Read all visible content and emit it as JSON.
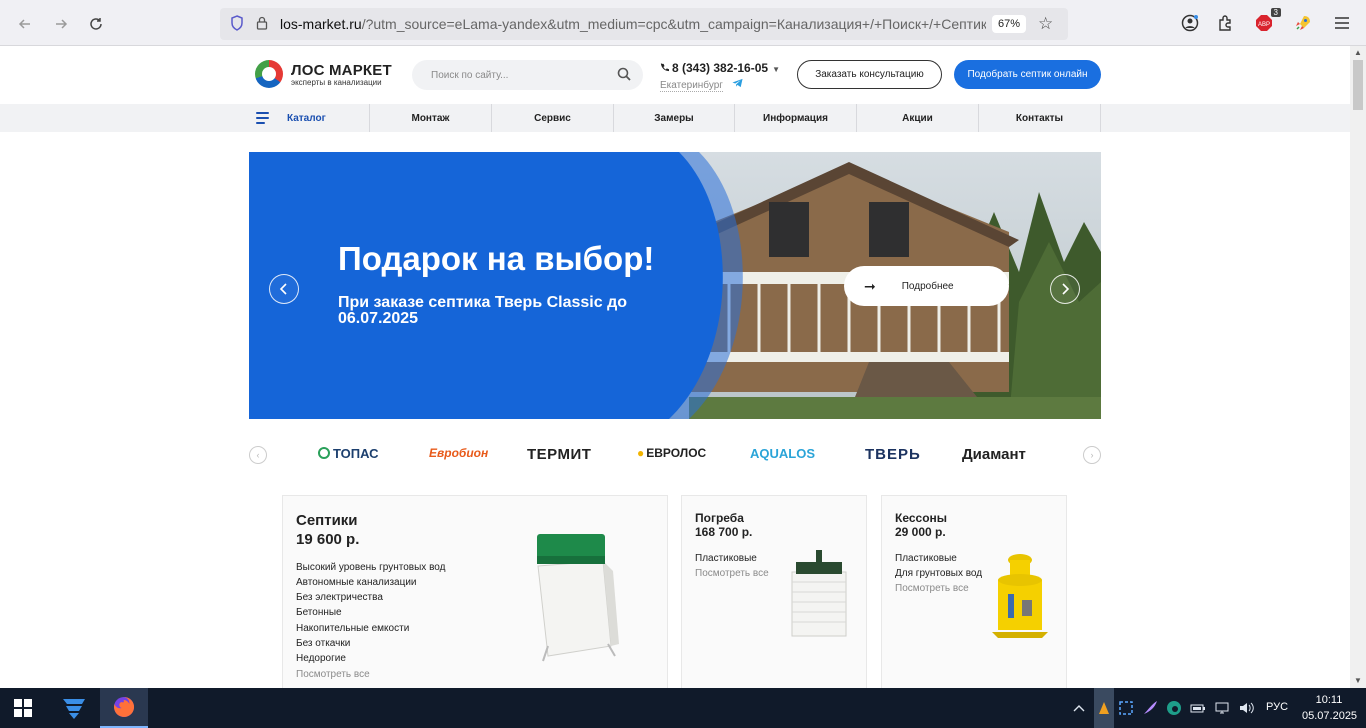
{
  "browser": {
    "url_host": "los-market.ru",
    "url_rest": "/?utm_source=eLama-yandex&utm_medium=cpc&utm_campaign=Канализация+/+Поиск+/+Септик",
    "zoom": "67%",
    "adblock_count": "3",
    "adblock_label": "ABP"
  },
  "site": {
    "logo_title": "ЛОС МАРКЕТ",
    "logo_sub": "эксперты в канализации",
    "search_placeholder": "Поиск по сайту...",
    "phone": "8 (343) 382-16-05",
    "city": "Екатеринбург",
    "consult_button": "Заказать консультацию",
    "online_button": "Подобрать септик онлайн"
  },
  "menu": {
    "items": [
      "Каталог",
      "Монтаж",
      "Сервис",
      "Замеры",
      "Информация",
      "Акции",
      "Контакты"
    ]
  },
  "banner": {
    "title": "Подарок на выбор!",
    "subtitle": "При заказе септика Тверь Classic до 06.07.2025",
    "more_button": "Подробнее"
  },
  "brands": [
    "ТОПАС",
    "Евробион",
    "ТЕРМИТ",
    "ЕВРОЛОС",
    "AQUALOS",
    "ТВЕРЬ",
    "Диамант"
  ],
  "cards": {
    "septic": {
      "title": "Септики",
      "price": "19 600 р.",
      "links": [
        "Высокий уровень грунтовых вод",
        "Автономные канализации",
        "Без электричества",
        "Бетонные",
        "Накопительные емкости",
        "Без откачки",
        "Недорогие"
      ],
      "all": "Посмотреть все"
    },
    "cellar": {
      "title": "Погреба",
      "price": "168 700 р.",
      "links": [
        "Пластиковые"
      ],
      "all": "Посмотреть все"
    },
    "caisson": {
      "title": "Кессоны",
      "price": "29 000 р.",
      "links": [
        "Пластиковые",
        "Для грунтовых вод"
      ],
      "all": "Посмотреть все"
    }
  },
  "taskbar": {
    "lang": "РУС",
    "time": "10:11",
    "date": "05.07.2025"
  },
  "colors": {
    "accent": "#1a6fe0",
    "banner_blue": "#1565d8",
    "nav_active": "#1a4fb0"
  }
}
